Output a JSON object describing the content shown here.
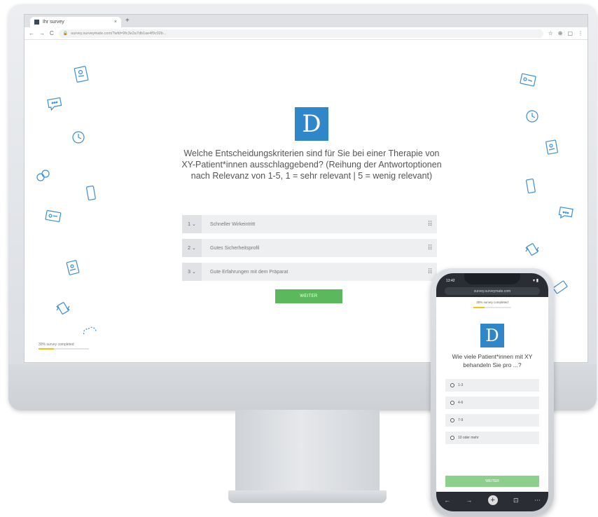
{
  "desktop": {
    "browser": {
      "tab_title": "Ihr survey",
      "tab_close": "×",
      "new_tab": "+",
      "url": "survey.surveymate.com/?wfd=9fc3e2a7db1ae4f9c02b...",
      "nav": {
        "back": "←",
        "forward": "→",
        "reload": "C"
      },
      "toolbar_icons": [
        "☆",
        "⊕",
        "▢",
        "⋮"
      ]
    },
    "logo_letter": "D",
    "question": "Welche Entscheidungskriterien sind für Sie bei einer Therapie von XY-Patient*innen ausschlaggebend? (Reihung der Antwortoptionen nach Relevanz von 1-5, 1 = sehr relevant | 5 = wenig relevant)",
    "ranking_items": [
      {
        "rank": "1 ⌄",
        "label": "Schneller Wirkeintritt",
        "handle": "⠿"
      },
      {
        "rank": "2 ⌄",
        "label": "Gutes Sicherheitsprofil",
        "handle": "⠿"
      },
      {
        "rank": "3 ⌄",
        "label": "Gute Erfahrungen mit dem Präparat",
        "handle": "⠿"
      }
    ],
    "next_label": "WEITER",
    "progress_label": "30% survey completed",
    "progress_percent": 30,
    "decor_icons": [
      "id-card-icon",
      "chat-icon",
      "clock-icon",
      "pills-icon",
      "phone-icon",
      "id-card-icon",
      "document-icon",
      "tablet-vibrate-icon",
      "cloud-icon",
      "id-card-icon",
      "clock-icon",
      "document-icon",
      "phone-icon",
      "chat-icon",
      "tablet-vibrate-icon",
      "ticket-icon"
    ]
  },
  "phone": {
    "time": "13:42",
    "status_icons": "▾ ▮",
    "url": "survey.surveymate.com",
    "progress_label": "30% survey completed",
    "progress_percent": 30,
    "logo_letter": "D",
    "question": "Wie viele Patient*innen mit XY behandeln Sie pro ...?",
    "options": [
      "1-3",
      "4-6",
      "7-9",
      "10 oder mehr"
    ],
    "next_label": "WEITER",
    "nav": {
      "back": "←",
      "forward": "→",
      "add": "+",
      "tabs": "⊡",
      "menu": "⋯"
    }
  },
  "colors": {
    "brand_blue": "#2f86c8",
    "accent_green": "#5cb85c",
    "progress_yellow": "#f1c40f",
    "icon_blue": "#3a8fd6"
  }
}
